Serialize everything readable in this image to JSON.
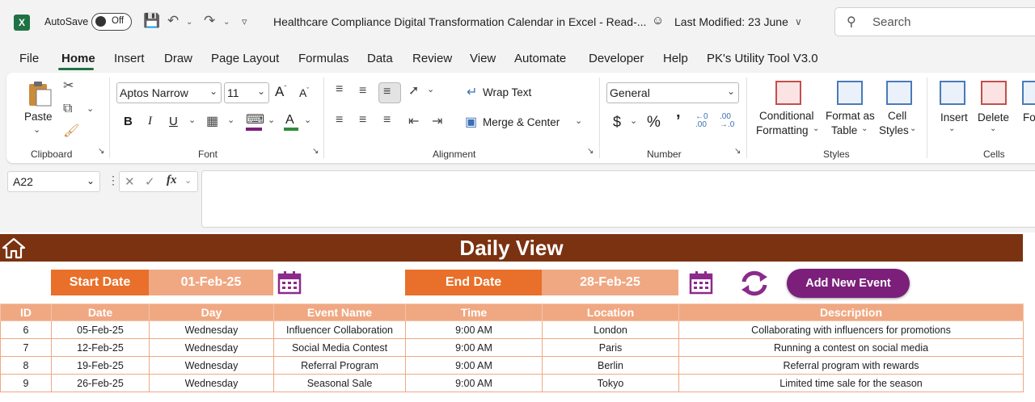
{
  "titlebar": {
    "app_icon": "X",
    "autosave_label": "AutoSave",
    "autosave_state": "Off",
    "doc_title": "Healthcare Compliance Digital Transformation Calendar in Excel  -  Read-...",
    "last_modified": "Last Modified: 23 June",
    "search_placeholder": "Search"
  },
  "menu": {
    "tabs": [
      "File",
      "Home",
      "Insert",
      "Draw",
      "Page Layout",
      "Formulas",
      "Data",
      "Review",
      "View",
      "Automate",
      "Developer",
      "Help",
      "PK's Utility Tool V3.0"
    ],
    "active": "Home"
  },
  "ribbon": {
    "clipboard": {
      "paste": "Paste",
      "label": "Clipboard"
    },
    "font": {
      "family": "Aptos Narrow",
      "size": "11",
      "label": "Font"
    },
    "alignment": {
      "wrap_text": "Wrap Text",
      "merge_center": "Merge & Center",
      "label": "Alignment"
    },
    "number": {
      "format": "General",
      "label": "Number"
    },
    "styles": {
      "conditional_1": "Conditional",
      "conditional_2": "Formatting",
      "format_table_1": "Format as",
      "format_table_2": "Table",
      "cell_styles_1": "Cell",
      "cell_styles_2": "Styles",
      "label": "Styles"
    },
    "cells": {
      "insert": "Insert",
      "delete": "Delete",
      "format": "Forn",
      "label": "Cells"
    }
  },
  "formula_bar": {
    "name_box": "A22",
    "fx": "fx",
    "value": ""
  },
  "sheet": {
    "banner_title": "Daily View",
    "start_date_label": "Start Date",
    "start_date_value": "01-Feb-25",
    "end_date_label": "End Date",
    "end_date_value": "28-Feb-25",
    "add_event_label": "Add New Event",
    "columns": [
      "ID",
      "Date",
      "Day",
      "Event Name",
      "Time",
      "Location",
      "Description"
    ],
    "rows": [
      [
        "6",
        "05-Feb-25",
        "Wednesday",
        "Influencer Collaboration",
        "9:00 AM",
        "London",
        "Collaborating with influencers for promotions"
      ],
      [
        "7",
        "12-Feb-25",
        "Wednesday",
        "Social Media Contest",
        "9:00 AM",
        "Paris",
        "Running a contest on social media"
      ],
      [
        "8",
        "19-Feb-25",
        "Wednesday",
        "Referral Program",
        "9:00 AM",
        "Berlin",
        "Referral program with rewards"
      ],
      [
        "9",
        "26-Feb-25",
        "Wednesday",
        "Seasonal Sale",
        "9:00 AM",
        "Tokyo",
        "Limited time sale for the season"
      ]
    ]
  },
  "colors": {
    "banner": "#7b3210",
    "orange": "#e8702a",
    "peach": "#f0a882",
    "button_purple": "#7b1f7a",
    "excel_green": "#1f7244"
  }
}
